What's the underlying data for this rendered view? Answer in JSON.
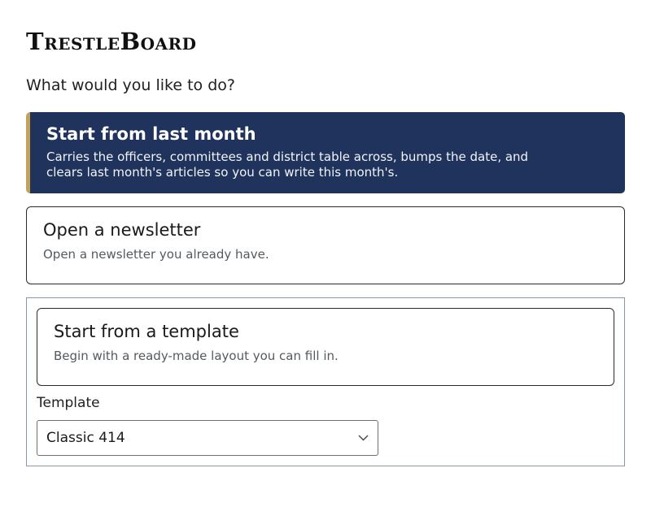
{
  "app": {
    "brand": "TrestleBoard",
    "prompt": "What would you like to do?"
  },
  "options": {
    "last_month": {
      "title": "Start from last month",
      "description": "Carries the officers, committees and district table across, bumps the date, and clears last month's articles so you can write this month's."
    },
    "open": {
      "title": "Open a newsletter",
      "description": "Open a newsletter you already have."
    },
    "template": {
      "title": "Start from a template",
      "description": "Begin with a ready-made layout you can fill in.",
      "field_label": "Template",
      "selected": "Classic 414"
    }
  },
  "colors": {
    "primary": "#1f335c",
    "accent": "#c2a15a",
    "panel_border": "#8a97ab"
  },
  "icons": {
    "select": "chevron-down-icon"
  }
}
